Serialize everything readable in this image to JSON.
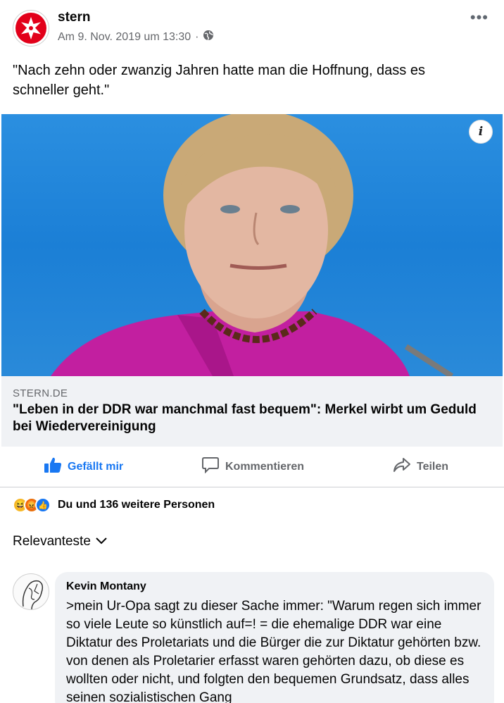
{
  "post": {
    "page_name": "stern",
    "timestamp": "Am 9. Nov. 2019 um 13:30",
    "separator": "·",
    "privacy_icon": "globe-icon",
    "more_icon": "ellipsis-icon",
    "text": "\"Nach zehn oder zwanzig Jahren hatte man die Hoffnung, dass es schneller geht.\""
  },
  "photo": {
    "info_label": "i"
  },
  "link": {
    "domain": "STERN.DE",
    "title": "\"Leben in der DDR war manchmal fast bequem\": Merkel wirbt um Geduld bei Wiedervereinigung"
  },
  "actions": {
    "like_label": "Gefällt mir",
    "comment_label": "Kommentieren",
    "share_label": "Teilen"
  },
  "reactions": {
    "icons": [
      "haha",
      "angry",
      "like"
    ],
    "summary": "Du und 136 weitere Personen"
  },
  "sort": {
    "label": "Relevanteste"
  },
  "comment": {
    "author": "Kevin Montany",
    "text": ">mein Ur-Opa sagt zu dieser Sache immer: \"Warum regen sich immer so viele Leute so künstlich auf=! = die ehemalige DDR war eine Diktatur des Proletariats und die Bürger die zur Diktatur gehörten bzw. von denen als Proletarier erfasst waren gehörten dazu, ob diese es wollten oder nicht, und  folgten den bequemen Grundsatz, dass alles seinen sozialistischen Gang"
  },
  "colors": {
    "accent": "#1877f2",
    "brand_red": "#e2001a",
    "secondary_text": "#65676b",
    "bubble_bg": "#f0f2f5"
  }
}
